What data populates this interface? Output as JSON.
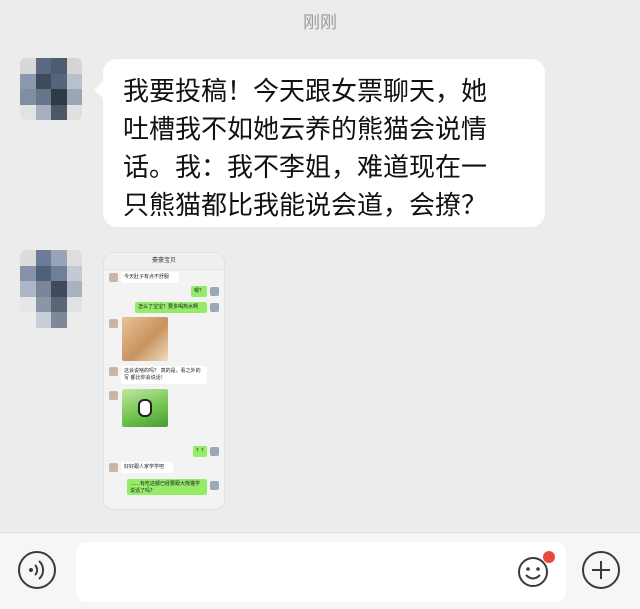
{
  "chat": {
    "timestamp": "刚刚",
    "messages": [
      {
        "type": "text",
        "lines": [
          "我要投稿！今天跟女票聊天，她",
          "吐槽我不如她云养的熊猫会说情",
          "话。我：我不李姐，难道现在一",
          "只熊猫都比我能说会道，会撩？"
        ]
      },
      {
        "type": "image",
        "screenshot": {
          "header": "豪豪宝贝",
          "bubbles": [
            "今天肚子有点不舒服",
            "嗯？",
            "怎么了宝宝？要多喝热水啊",
            "这会说啥的吗？ 真的是，看之外的写 都比你会说话！",
            "？？",
            "好好跟人家学学吧",
            "……有吃这都已经要跟大熊猫学说话了吗？"
          ]
        }
      }
    ]
  },
  "bottom_bar": {
    "voice_icon": "voice-icon",
    "emoji_icon": "emoji-icon",
    "add_icon": "plus-icon",
    "notification_color": "#e84b3c"
  }
}
